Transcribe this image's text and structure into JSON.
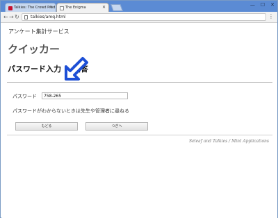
{
  "browser": {
    "tabs": [
      {
        "title": "Talkies: The Crowd Prod"
      },
      {
        "title": "The Enigma"
      }
    ],
    "url": "talkies/amq.html"
  },
  "page": {
    "service_name": "アンケート集計サービス",
    "app_title": "クイッカー",
    "heading": "パスワード入力 > 回答",
    "password_label": "パスワード",
    "password_value": "758-265",
    "help_text": "パスワードがわからないときは先生や管理者に尋ねる",
    "back_button": "もどる",
    "next_button": "つぎへ",
    "footer": "Seleaf and Talkies / Mint Applications"
  },
  "colors": {
    "arrow": "#1d4fd6",
    "titlebar": "#5b8bd4"
  }
}
